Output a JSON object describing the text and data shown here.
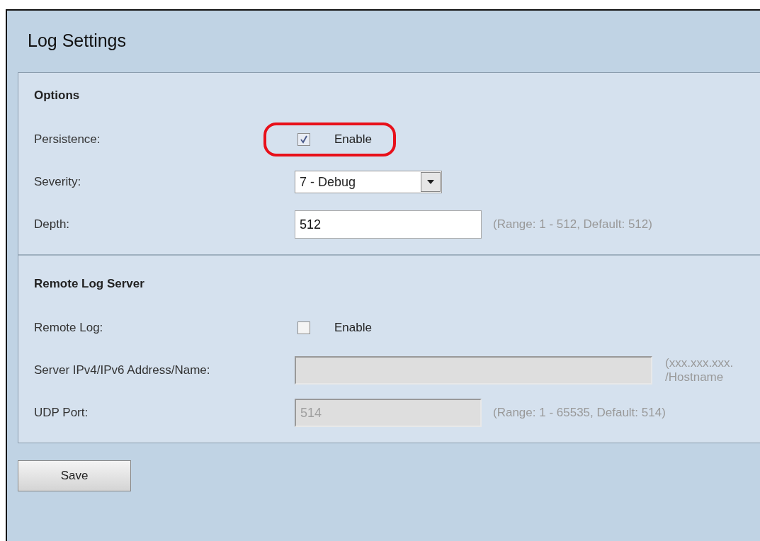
{
  "title": "Log Settings",
  "sections": [
    {
      "heading": "Options",
      "rows": [
        {
          "kind": "checkbox",
          "label": "Persistence:",
          "checked": true,
          "text": "Enable",
          "highlighted": true
        },
        {
          "kind": "select",
          "label": "Severity:",
          "value": "7 - Debug"
        },
        {
          "kind": "text",
          "label": "Depth:",
          "value": "512",
          "disabled": false,
          "hint": [
            "(Range: 1 - 512, Default: 512)"
          ]
        }
      ]
    },
    {
      "heading": "Remote Log Server",
      "rows": [
        {
          "kind": "checkbox",
          "label": "Remote Log:",
          "checked": false,
          "text": "Enable",
          "highlighted": false
        },
        {
          "kind": "wide",
          "label": "Server IPv4/IPv6 Address/Name:",
          "disabled": true,
          "hint": [
            "(xxx.xxx.xxx.",
            "/Hostname"
          ]
        },
        {
          "kind": "text",
          "label": "UDP Port:",
          "value": "514",
          "disabled": true,
          "hint": [
            "(Range: 1 - 65535, Default: 514)"
          ]
        }
      ]
    }
  ],
  "save": "Save"
}
